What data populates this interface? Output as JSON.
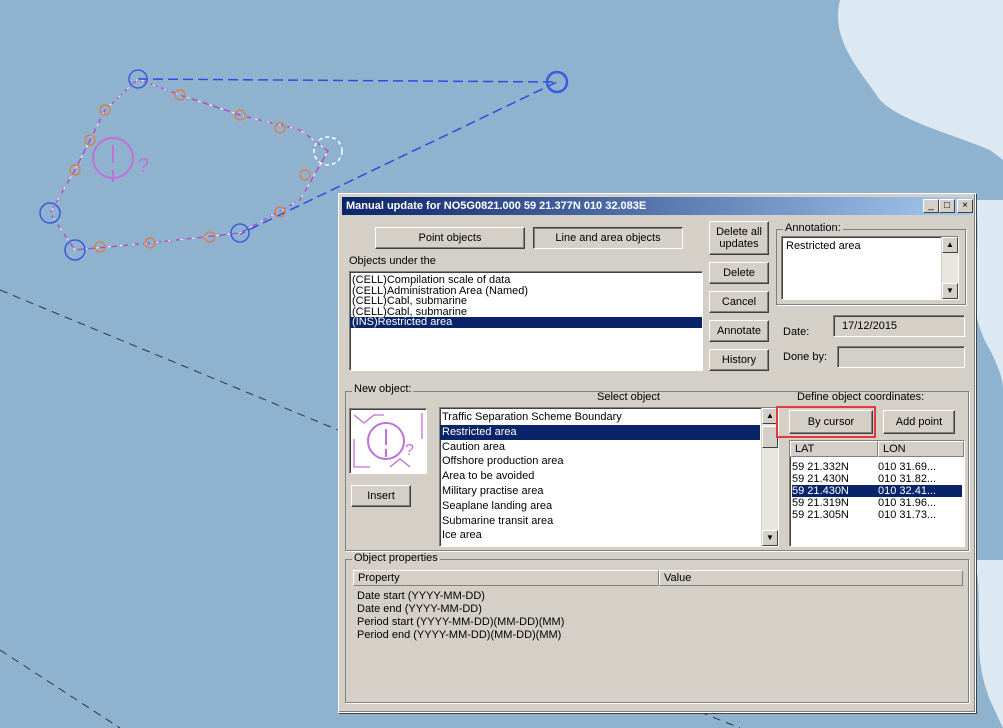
{
  "window": {
    "title": "Manual update for NO5G0821.000  59 21.377N  010 32.083E",
    "min_glyph": "_",
    "max_glyph": "□",
    "close_glyph": "×"
  },
  "tabs": {
    "point": "Point objects",
    "line_area": "Line and area objects"
  },
  "objects_under": {
    "label": "Objects under the",
    "items": [
      "(CELL)Compilation scale of data",
      "(CELL)Administration Area (Named)",
      "(CELL)Cabl, submarine",
      "(CELL)Cabl, submarine",
      "(INS)Restricted area"
    ],
    "selected_index": 4
  },
  "buttons": {
    "delete_all_1": "Delete all",
    "delete_all_2": "updates",
    "delete": "Delete",
    "cancel": "Cancel",
    "annotate": "Annotate",
    "history": "History",
    "insert": "Insert",
    "by_cursor": "By cursor",
    "add_point": "Add point"
  },
  "annotation": {
    "label": "Annotation:",
    "text": "Restricted area"
  },
  "date": {
    "label": "Date:",
    "value": "17/12/2015"
  },
  "done_by": {
    "label": "Done by:",
    "value": ""
  },
  "new_object": {
    "label": "New object:",
    "select_label": "Select object",
    "items": [
      "Traffic Separation Scheme  Boundary",
      "Restricted area",
      "Caution area",
      "Offshore production area",
      "Area to be avoided",
      "Military practise area",
      "Seaplane landing area",
      "Submarine transit area",
      "Ice area"
    ],
    "selected_index": 1
  },
  "coords": {
    "label": "Define object coordinates:",
    "headers": [
      "LAT",
      "LON"
    ],
    "rows": [
      [
        "59 21.332N",
        "010 31.69..."
      ],
      [
        "59 21.430N",
        "010 31.82..."
      ],
      [
        "59 21.430N",
        "010 32.41..."
      ],
      [
        "59 21.319N",
        "010 31.96..."
      ],
      [
        "59 21.305N",
        "010 31.73..."
      ]
    ],
    "selected_index": 2
  },
  "properties": {
    "label": "Object properties",
    "headers": [
      "Property",
      "Value"
    ],
    "rows": [
      "Date start (YYYY-MM-DD)",
      "Date end (YYYY-MM-DD)",
      "Period start (YYYY-MM-DD)(MM-DD)(MM)",
      "Period end (YYYY-MM-DD)(MM-DD)(MM)"
    ]
  },
  "map": {
    "restricted_symbol_text": "?"
  },
  "colors": {
    "highlight_box": "#e23a3a",
    "selection": "#0a246a",
    "land": "#dde9f2",
    "sea": "#8fb3cf"
  }
}
